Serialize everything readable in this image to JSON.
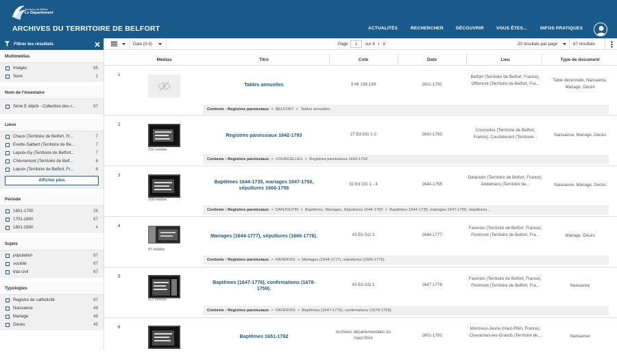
{
  "header": {
    "logo_line1": "Territoire de Belfort",
    "logo_line2": "Le Département",
    "site_title": "ARCHIVES DU TERRITOIRE DE BELFORT",
    "nav": [
      "ACTUALITÉS",
      "RECHERCHER",
      "DÉCOUVRIR",
      "VOUS ÊTES...",
      "INFOS PRATIQUES"
    ]
  },
  "sidebar": {
    "title": "Filtrer les résultats",
    "sections": [
      {
        "title": "Multimédias",
        "items": [
          {
            "label": "Images",
            "count": "65"
          },
          {
            "label": "Sans",
            "count": "2"
          }
        ]
      },
      {
        "title": "Nom de l'inventaire",
        "items": [
          {
            "label": "Série E dépôt - Collection des r...",
            "count": "67"
          }
        ]
      },
      {
        "title": "Lieux",
        "items": [
          {
            "label": "Chaux (Territoire de Belfort, Fr...",
            "count": "7"
          },
          {
            "label": "Evette-Salbert (Territoire de Be...",
            "count": "7"
          },
          {
            "label": "Lepuix-Gy (Territoire de Belfort...",
            "count": "7"
          },
          {
            "label": "Chèvremont (Territoire de Belf...",
            "count": "6"
          },
          {
            "label": "Lepuix (Territoire de Belfort, Fr...",
            "count": "6"
          }
        ],
        "more": "Afficher plus"
      },
      {
        "title": "Période",
        "items": [
          {
            "label": "1601-1700",
            "count": "26"
          },
          {
            "label": "1701-1800",
            "count": "67"
          },
          {
            "label": "1801-1900",
            "count": "4"
          }
        ]
      },
      {
        "title": "Sujets",
        "items": [
          {
            "label": "population",
            "count": "67"
          },
          {
            "label": "société",
            "count": "67"
          },
          {
            "label": "état civil",
            "count": "67"
          }
        ]
      },
      {
        "title": "Typologies",
        "items": [
          {
            "label": "Registre de catholicité",
            "count": "67"
          },
          {
            "label": "Naissance",
            "count": "49"
          },
          {
            "label": "Mariage",
            "count": "48"
          },
          {
            "label": "Décès",
            "count": "45"
          }
        ]
      }
    ]
  },
  "toolbar": {
    "sort": "Date (0-9)",
    "page_label": "Page",
    "page_value": "1",
    "page_total": "sur 4",
    "per_page": "20 résultats par page",
    "results": "67 résultats"
  },
  "table": {
    "columns": [
      "Médias",
      "Titre",
      "Cote",
      "Date",
      "Lieu",
      "Type de document"
    ],
    "rows": [
      {
        "num": "1",
        "media": "",
        "title": "Tables annuelles",
        "cote": "5 Mi 138-139",
        "date": "1611-1792",
        "lieu": "Belfort (Territoire de Belfort, France), Offemont (Territoire de Belfort, Fra...",
        "type": "Table décennale, Naissance, Mariage, Décès",
        "ctx": [
          "Contexte : Registres paroissiaux",
          "BELFORT",
          "Tables annuelles"
        ]
      },
      {
        "num": "2",
        "media": "216 médias",
        "title": "Registres paroissiaux 1642-1793",
        "cote": "27 Ed GG 1-2",
        "date": "1642-1793",
        "lieu": "Courcelles (Territoire de Belfort, France), Courtelevant (Territoire...",
        "type": "Naissance, Mariage, Décès",
        "ctx": [
          "Contexte : Registres paroissiaux",
          "COURCELLES",
          "Registres paroissiaux 1642-1793"
        ]
      },
      {
        "num": "3",
        "media": "268 médias",
        "title": "Baptêmes 1644-1735, mariages 1647-1750, sépultures 1666-1756",
        "cote": "32 Ed GG 1 - 4",
        "date": "1644-1756",
        "lieu": "Danjoutin (Territoire de Belfort, France), Andelnans (Territoire de...",
        "type": "Naissance, Mariage, Décès",
        "ctx": [
          "Contexte : Registres paroissiaux",
          "DANJOUTIN",
          "Baptêmes, Mariages, Sépultures 1644-1792",
          "Baptêmes 1644-1735, mariages 1647-1750, sépultures..."
        ]
      },
      {
        "num": "4",
        "media": "87 médias",
        "title": "Mariages (1644-1777), sépultures (1666-1776).",
        "cote": "43 Ed GG 2",
        "date": "1644-1777",
        "lieu": "Faverois (Territoire de Belfort, France), Florimont (Territoire de Belfort, Fra...",
        "type": "Mariage, Décès",
        "ctx": [
          "Contexte : Registres paroissiaux",
          "FAVEROIS",
          "Mariages (1644-1777), sépultures (1666-1776)."
        ]
      },
      {
        "num": "5",
        "media": "115 médias",
        "title": "Baptêmes (1647-1776), confirmations (1678-1759).",
        "cote": "43 Ed GG 1",
        "date": "1647-1776",
        "lieu": "Faverois (Territoire de Belfort, France), Florimont (Territoire de Belfort, Fra...",
        "type": "Naissance",
        "ctx": [
          "Contexte : Registres paroissiaux",
          "FAVEROIS",
          "Baptêmes (1647-1776), confirmations (1678-1759)."
        ]
      },
      {
        "num": "6",
        "media": "",
        "title": "Baptêmes 1651-1792",
        "cote": "Archives départementales du Haut-Rhin",
        "date": "1651-1792",
        "lieu": "Montreux-Jeune (Haut-Rhin, France), Chavannes-les-Grands (Territoire de...",
        "type": "Naissance",
        "ctx": []
      }
    ]
  },
  "colors": {
    "primary": "#1a5a8a",
    "panel": "#f0f0f0"
  }
}
